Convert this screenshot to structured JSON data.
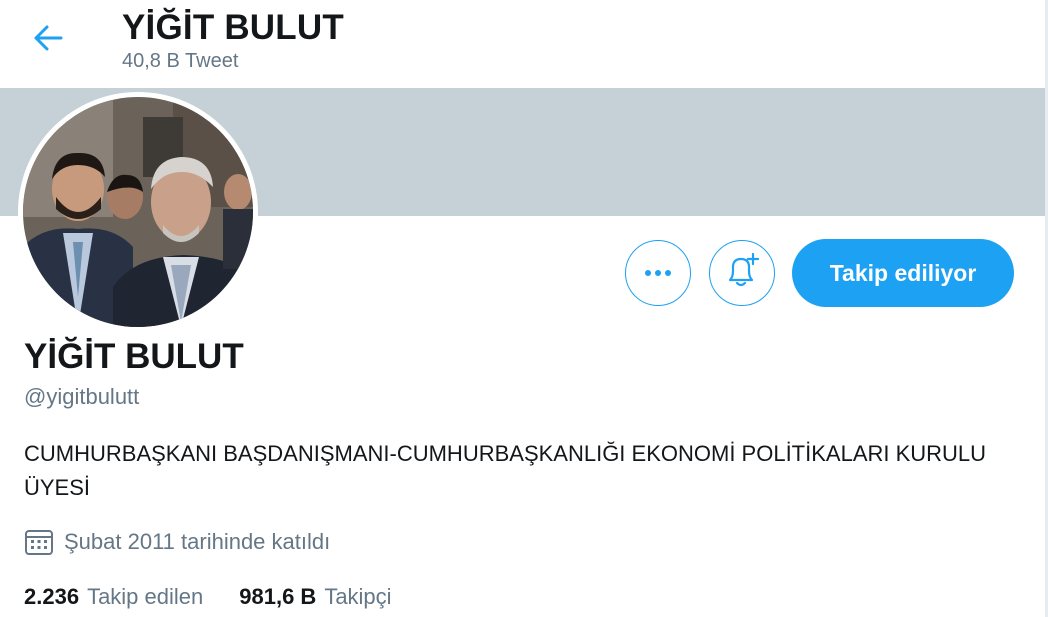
{
  "header": {
    "back_icon": "arrow-left-icon",
    "title": "YİĞİT BULUT",
    "tweet_count": "40,8 B Tweet"
  },
  "profile": {
    "name": "YİĞİT BULUT",
    "handle": "@yigitbulutt",
    "bio": "CUMHURBAŞKANI BAŞDANIŞMANI-CUMHURBAŞKANLIĞI EKONOMİ POLİTİKALARI KURULU ÜYESİ",
    "joined_icon": "calendar-icon",
    "joined": "Şubat 2011 tarihinde katıldı"
  },
  "actions": {
    "more_icon": "more-icon",
    "notify_icon": "bell-plus-icon",
    "follow_label": "Takip ediliyor"
  },
  "stats": {
    "following_count": "2.236",
    "following_label": "Takip edilen",
    "followers_count": "981,6 B",
    "followers_label": "Takipçi"
  },
  "colors": {
    "accent": "#1da1f2",
    "banner": "#c5d1d7",
    "secondary_text": "#657786",
    "primary_text": "#14171a"
  }
}
